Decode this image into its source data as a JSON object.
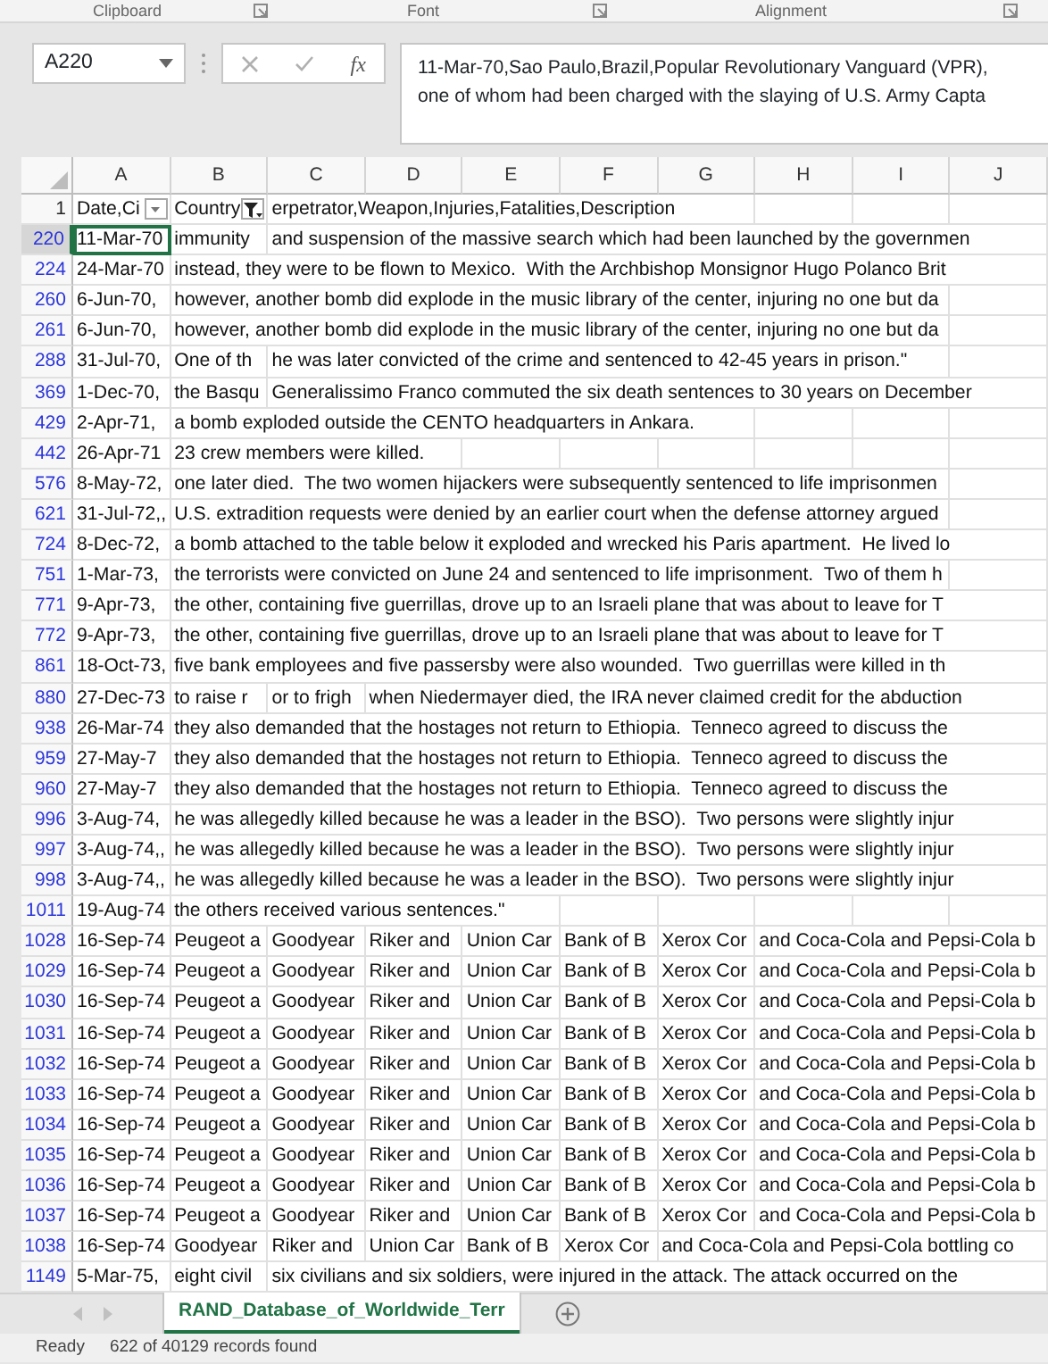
{
  "ribbon_groups": [
    {
      "label": "Clipboard"
    },
    {
      "label": "Font"
    },
    {
      "label": "Alignment"
    }
  ],
  "formula_bar": {
    "name_box": "A220",
    "function_label": "fx",
    "formula_lines": [
      "11-Mar-70,Sao Paulo,Brazil,Popular Revolutionary Vanguard (VPR),",
      "one of whom had been charged with the slaying of U.S. Army Capta"
    ]
  },
  "columns": [
    "A",
    "B",
    "C",
    "D",
    "E",
    "F",
    "G",
    "H",
    "I",
    "J"
  ],
  "rows": [
    {
      "number": "1",
      "filtered": false,
      "cells": [
        {
          "text": "Date,Ci",
          "selected": false,
          "filter_active": false
        },
        {
          "text": "Country",
          "selected": false,
          "filter_active": true
        },
        {
          "text": "erpetrator,Weapon,Injuries,Fatalities,Description",
          "selected": false
        }
      ]
    },
    {
      "number": "220",
      "filtered": true,
      "cells": [
        {
          "text": "11-Mar-70",
          "selected": true
        },
        {
          "text": "immunity",
          "selected": false
        },
        {
          "text": "and suspension of the massive search which had been launched by the governmen",
          "selected": false
        }
      ]
    },
    {
      "number": "224",
      "filtered": true,
      "cells": [
        {
          "text": "24-Mar-70",
          "selected": false
        },
        {
          "text": "instead, they were to be flown to Mexico.  With the Archbishop Monsignor Hugo Polanco Brit",
          "selected": false
        }
      ]
    },
    {
      "number": "260",
      "filtered": true,
      "cells": [
        {
          "text": "6-Jun-70,",
          "selected": false
        },
        {
          "text": "however, another bomb did explode in the music library of the center, injuring no one but da",
          "selected": false
        }
      ]
    },
    {
      "number": "261",
      "filtered": true,
      "cells": [
        {
          "text": "6-Jun-70,",
          "selected": false
        },
        {
          "text": "however, another bomb did explode in the music library of the center, injuring no one but da",
          "selected": false
        }
      ]
    },
    {
      "number": "288",
      "filtered": true,
      "cells": [
        {
          "text": "31-Jul-70,",
          "selected": false
        },
        {
          "text": "One of th",
          "selected": false
        },
        {
          "text": "he was later convicted of the crime and sentenced to 42-45 years in prison.\"",
          "selected": false
        }
      ]
    },
    {
      "number": "369",
      "filtered": true,
      "cells": [
        {
          "text": "1-Dec-70,",
          "selected": false
        },
        {
          "text": "the Basqu",
          "selected": false
        },
        {
          "text": "Generalissimo Franco commuted the six death sentences to 30 years on December",
          "selected": false
        }
      ]
    },
    {
      "number": "429",
      "filtered": true,
      "cells": [
        {
          "text": "2-Apr-71,",
          "selected": false
        },
        {
          "text": "a bomb exploded outside the CENTO headquarters in Ankara.",
          "selected": false
        }
      ]
    },
    {
      "number": "442",
      "filtered": true,
      "cells": [
        {
          "text": "26-Apr-71",
          "selected": false
        },
        {
          "text": "23 crew members were killed.",
          "selected": false
        }
      ]
    },
    {
      "number": "576",
      "filtered": true,
      "cells": [
        {
          "text": "8-May-72,",
          "selected": false
        },
        {
          "text": "one later died.  The two women hijackers were subsequently sentenced to life imprisonmen",
          "selected": false
        }
      ]
    },
    {
      "number": "621",
      "filtered": true,
      "cells": [
        {
          "text": "31-Jul-72,,",
          "selected": false
        },
        {
          "text": "U.S. extradition requests were denied by an earlier court when the defense attorney argued",
          "selected": false
        }
      ]
    },
    {
      "number": "724",
      "filtered": true,
      "cells": [
        {
          "text": "8-Dec-72,",
          "selected": false
        },
        {
          "text": "a bomb attached to the table below it exploded and wrecked his Paris apartment.  He lived lo",
          "selected": false
        }
      ]
    },
    {
      "number": "751",
      "filtered": true,
      "cells": [
        {
          "text": "1-Mar-73,",
          "selected": false
        },
        {
          "text": "the terrorists were convicted on June 24 and sentenced to life imprisonment.  Two of them h",
          "selected": false
        }
      ]
    },
    {
      "number": "771",
      "filtered": true,
      "cells": [
        {
          "text": "9-Apr-73,",
          "selected": false
        },
        {
          "text": "the other, containing five guerrillas, drove up to an Israeli plane that was about to leave for T",
          "selected": false
        }
      ]
    },
    {
      "number": "772",
      "filtered": true,
      "cells": [
        {
          "text": "9-Apr-73,",
          "selected": false
        },
        {
          "text": "the other, containing five guerrillas, drove up to an Israeli plane that was about to leave for T",
          "selected": false
        }
      ]
    },
    {
      "number": "861",
      "filtered": true,
      "cells": [
        {
          "text": "18-Oct-73,",
          "selected": false
        },
        {
          "text": "five bank employees and five passersby were also wounded.  Two guerrillas were killed in th",
          "selected": false
        }
      ]
    },
    {
      "number": "880",
      "filtered": true,
      "cells": [
        {
          "text": "27-Dec-73",
          "selected": false
        },
        {
          "text": "to raise r",
          "selected": false
        },
        {
          "text": "or to frigh",
          "selected": false
        },
        {
          "text": "when Niedermayer died, the IRA never claimed credit for the abduction",
          "selected": false
        }
      ]
    },
    {
      "number": "938",
      "filtered": true,
      "cells": [
        {
          "text": "26-Mar-74",
          "selected": false
        },
        {
          "text": "they also demanded that the hostages not return to Ethiopia.  Tenneco agreed to discuss the",
          "selected": false
        }
      ]
    },
    {
      "number": "959",
      "filtered": true,
      "cells": [
        {
          "text": "27-May-7",
          "selected": false
        },
        {
          "text": "they also demanded that the hostages not return to Ethiopia.  Tenneco agreed to discuss the",
          "selected": false
        }
      ]
    },
    {
      "number": "960",
      "filtered": true,
      "cells": [
        {
          "text": "27-May-7",
          "selected": false
        },
        {
          "text": "they also demanded that the hostages not return to Ethiopia.  Tenneco agreed to discuss the",
          "selected": false
        }
      ]
    },
    {
      "number": "996",
      "filtered": true,
      "cells": [
        {
          "text": "3-Aug-74,",
          "selected": false
        },
        {
          "text": "he was allegedly killed because he was a leader in the BSO).  Two persons were slightly injur",
          "selected": false
        }
      ]
    },
    {
      "number": "997",
      "filtered": true,
      "cells": [
        {
          "text": "3-Aug-74,,",
          "selected": false
        },
        {
          "text": "he was allegedly killed because he was a leader in the BSO).  Two persons were slightly injur",
          "selected": false
        }
      ]
    },
    {
      "number": "998",
      "filtered": true,
      "cells": [
        {
          "text": "3-Aug-74,,",
          "selected": false
        },
        {
          "text": "he was allegedly killed because he was a leader in the BSO).  Two persons were slightly injur",
          "selected": false
        }
      ]
    },
    {
      "number": "1011",
      "filtered": true,
      "cells": [
        {
          "text": "19-Aug-74",
          "selected": false
        },
        {
          "text": "the others received various sentences.\"",
          "selected": false
        }
      ]
    },
    {
      "number": "1028",
      "filtered": true,
      "cells": [
        {
          "text": "16-Sep-74",
          "selected": false
        },
        {
          "text": "Peugeot a",
          "selected": false
        },
        {
          "text": "Goodyear",
          "selected": false
        },
        {
          "text": "Riker and",
          "selected": false
        },
        {
          "text": "Union Car",
          "selected": false
        },
        {
          "text": "Bank of B",
          "selected": false
        },
        {
          "text": "Xerox Cor",
          "selected": false
        },
        {
          "text": "and Coca-Cola and Pepsi-Cola b",
          "selected": false
        }
      ]
    },
    {
      "number": "1029",
      "filtered": true,
      "cells": [
        {
          "text": "16-Sep-74",
          "selected": false
        },
        {
          "text": "Peugeot a",
          "selected": false
        },
        {
          "text": "Goodyear",
          "selected": false
        },
        {
          "text": "Riker and",
          "selected": false
        },
        {
          "text": "Union Car",
          "selected": false
        },
        {
          "text": "Bank of B",
          "selected": false
        },
        {
          "text": "Xerox Cor",
          "selected": false
        },
        {
          "text": "and Coca-Cola and Pepsi-Cola b",
          "selected": false
        }
      ]
    },
    {
      "number": "1030",
      "filtered": true,
      "cells": [
        {
          "text": "16-Sep-74",
          "selected": false
        },
        {
          "text": "Peugeot a",
          "selected": false
        },
        {
          "text": "Goodyear",
          "selected": false
        },
        {
          "text": "Riker and",
          "selected": false
        },
        {
          "text": "Union Car",
          "selected": false
        },
        {
          "text": "Bank of B",
          "selected": false
        },
        {
          "text": "Xerox Cor",
          "selected": false
        },
        {
          "text": "and Coca-Cola and Pepsi-Cola b",
          "selected": false
        }
      ]
    },
    {
      "number": "1031",
      "filtered": true,
      "cells": [
        {
          "text": "16-Sep-74",
          "selected": false
        },
        {
          "text": "Peugeot a",
          "selected": false
        },
        {
          "text": "Goodyear",
          "selected": false
        },
        {
          "text": "Riker and",
          "selected": false
        },
        {
          "text": "Union Car",
          "selected": false
        },
        {
          "text": "Bank of B",
          "selected": false
        },
        {
          "text": "Xerox Cor",
          "selected": false
        },
        {
          "text": "and Coca-Cola and Pepsi-Cola b",
          "selected": false
        }
      ]
    },
    {
      "number": "1032",
      "filtered": true,
      "cells": [
        {
          "text": "16-Sep-74",
          "selected": false
        },
        {
          "text": "Peugeot a",
          "selected": false
        },
        {
          "text": "Goodyear",
          "selected": false
        },
        {
          "text": "Riker and",
          "selected": false
        },
        {
          "text": "Union Car",
          "selected": false
        },
        {
          "text": "Bank of B",
          "selected": false
        },
        {
          "text": "Xerox Cor",
          "selected": false
        },
        {
          "text": "and Coca-Cola and Pepsi-Cola b",
          "selected": false
        }
      ]
    },
    {
      "number": "1033",
      "filtered": true,
      "cells": [
        {
          "text": "16-Sep-74",
          "selected": false
        },
        {
          "text": "Peugeot a",
          "selected": false
        },
        {
          "text": "Goodyear",
          "selected": false
        },
        {
          "text": "Riker and",
          "selected": false
        },
        {
          "text": "Union Car",
          "selected": false
        },
        {
          "text": "Bank of B",
          "selected": false
        },
        {
          "text": "Xerox Cor",
          "selected": false
        },
        {
          "text": "and Coca-Cola and Pepsi-Cola b",
          "selected": false
        }
      ]
    },
    {
      "number": "1034",
      "filtered": true,
      "cells": [
        {
          "text": "16-Sep-74",
          "selected": false
        },
        {
          "text": "Peugeot a",
          "selected": false
        },
        {
          "text": "Goodyear",
          "selected": false
        },
        {
          "text": "Riker and",
          "selected": false
        },
        {
          "text": "Union Car",
          "selected": false
        },
        {
          "text": "Bank of B",
          "selected": false
        },
        {
          "text": "Xerox Cor",
          "selected": false
        },
        {
          "text": "and Coca-Cola and Pepsi-Cola b",
          "selected": false
        }
      ]
    },
    {
      "number": "1035",
      "filtered": true,
      "cells": [
        {
          "text": "16-Sep-74",
          "selected": false
        },
        {
          "text": "Peugeot a",
          "selected": false
        },
        {
          "text": "Goodyear",
          "selected": false
        },
        {
          "text": "Riker and",
          "selected": false
        },
        {
          "text": "Union Car",
          "selected": false
        },
        {
          "text": "Bank of B",
          "selected": false
        },
        {
          "text": "Xerox Cor",
          "selected": false
        },
        {
          "text": "and Coca-Cola and Pepsi-Cola b",
          "selected": false
        }
      ]
    },
    {
      "number": "1036",
      "filtered": true,
      "cells": [
        {
          "text": "16-Sep-74",
          "selected": false
        },
        {
          "text": "Peugeot a",
          "selected": false
        },
        {
          "text": "Goodyear",
          "selected": false
        },
        {
          "text": "Riker and",
          "selected": false
        },
        {
          "text": "Union Car",
          "selected": false
        },
        {
          "text": "Bank of B",
          "selected": false
        },
        {
          "text": "Xerox Cor",
          "selected": false
        },
        {
          "text": "and Coca-Cola and Pepsi-Cola b",
          "selected": false
        }
      ]
    },
    {
      "number": "1037",
      "filtered": true,
      "cells": [
        {
          "text": "16-Sep-74",
          "selected": false
        },
        {
          "text": "Peugeot a",
          "selected": false
        },
        {
          "text": "Goodyear",
          "selected": false
        },
        {
          "text": "Riker and",
          "selected": false
        },
        {
          "text": "Union Car",
          "selected": false
        },
        {
          "text": "Bank of B",
          "selected": false
        },
        {
          "text": "Xerox Cor",
          "selected": false
        },
        {
          "text": "and Coca-Cola and Pepsi-Cola b",
          "selected": false
        }
      ]
    },
    {
      "number": "1038",
      "filtered": true,
      "cells": [
        {
          "text": "16-Sep-74",
          "selected": false
        },
        {
          "text": "Goodyear",
          "selected": false
        },
        {
          "text": "Riker and",
          "selected": false
        },
        {
          "text": "Union Car",
          "selected": false
        },
        {
          "text": "Bank of B",
          "selected": false
        },
        {
          "text": "Xerox Cor",
          "selected": false
        },
        {
          "text": "and Coca-Cola and Pepsi-Cola bottling co",
          "selected": false
        }
      ]
    },
    {
      "number": "1149",
      "filtered": true,
      "cells": [
        {
          "text": "5-Mar-75,",
          "selected": false
        },
        {
          "text": "eight civil",
          "selected": false
        },
        {
          "text": "six civilians and six soldiers, were injured in the attack. The attack occurred on the",
          "selected": false
        }
      ]
    }
  ],
  "sheet_tabs": [
    {
      "label": "RAND_Database_of_Worldwide_Terr",
      "selected": true
    }
  ],
  "status_bar": {
    "mode": "Ready",
    "message": "622 of 40129 records found"
  }
}
